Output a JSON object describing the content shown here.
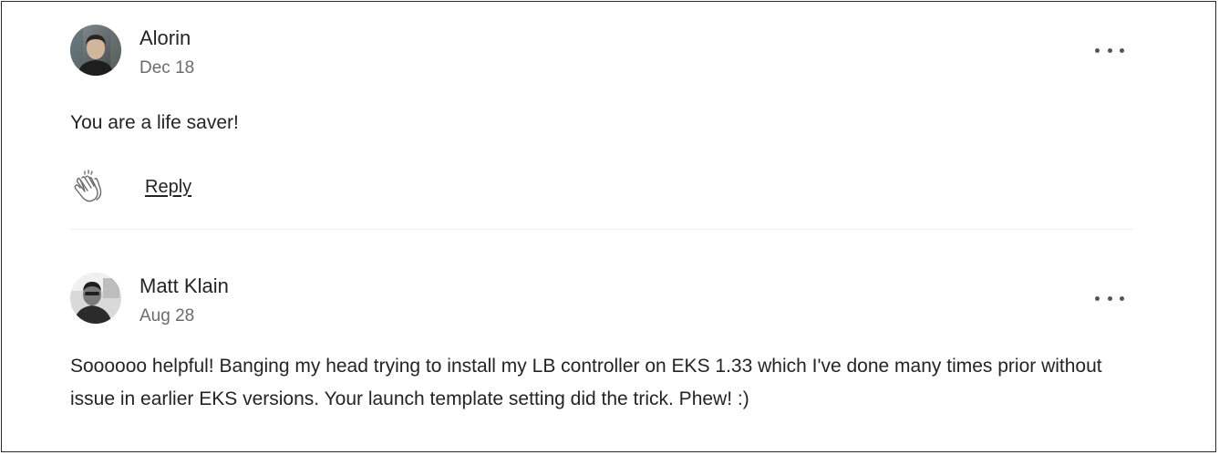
{
  "comments": [
    {
      "author": "Alorin",
      "date": "Dec 18",
      "text": "You are a life saver!",
      "reply_label": "Reply",
      "avatar_icon": "user-avatar",
      "clap_icon": "clap-icon",
      "more_icon": "more-icon"
    },
    {
      "author": "Matt Klain",
      "date": "Aug 28",
      "text": "Soooooo helpful! Banging my head trying to install my LB controller on EKS 1.33 which I've done many times prior without issue in earlier EKS versions. Your launch template setting did the trick. Phew! :)",
      "avatar_icon": "user-avatar",
      "more_icon": "more-icon"
    }
  ],
  "colors": {
    "text": "#242424",
    "muted": "#6b6b6b",
    "divider": "#ececec"
  }
}
